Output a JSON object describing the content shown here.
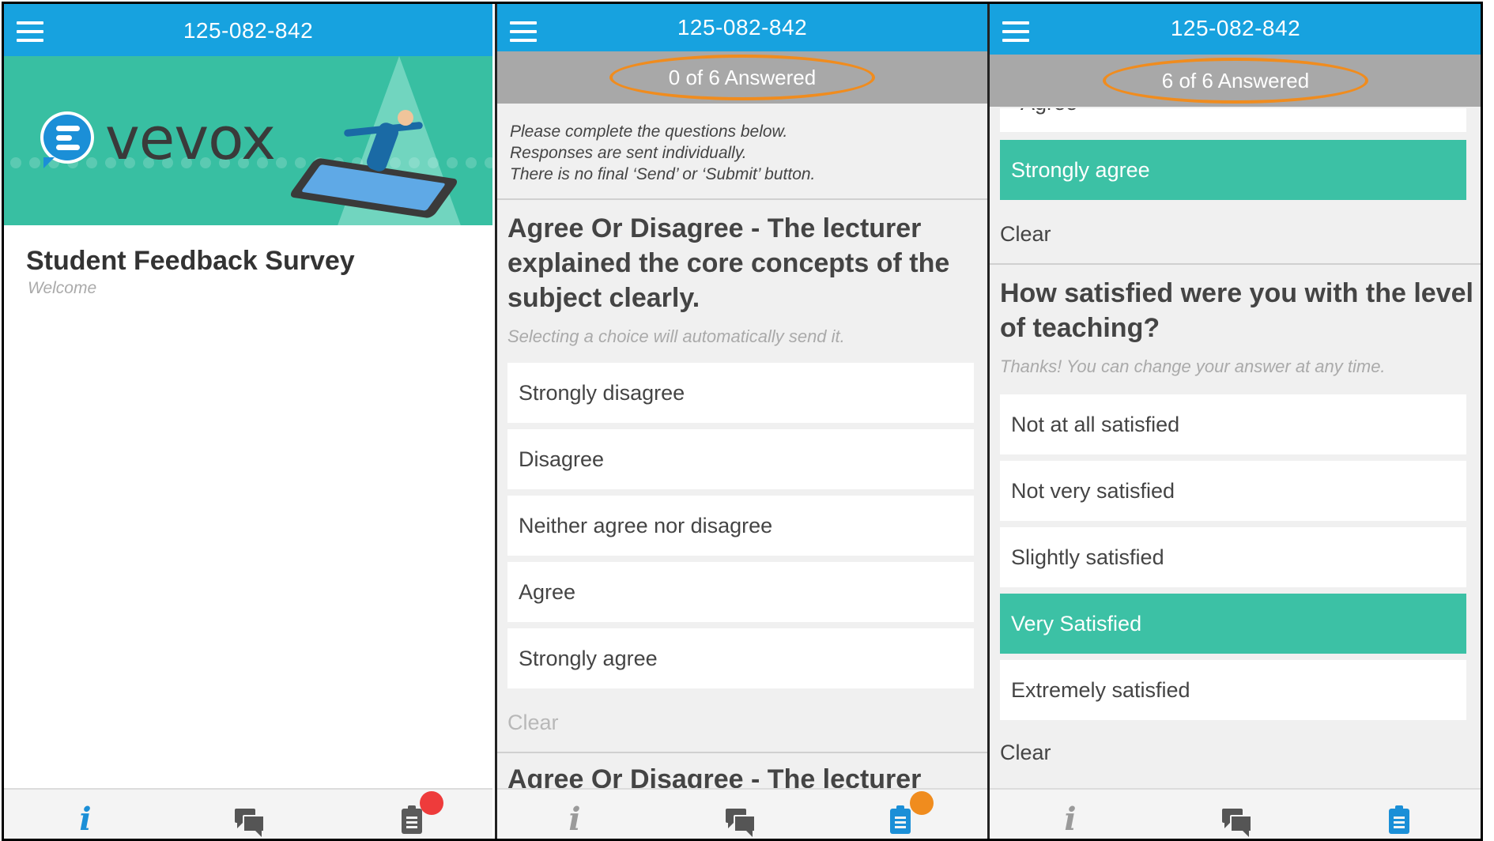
{
  "panels": [
    {
      "session_id": "125-082-842",
      "logo_text": "vevox",
      "survey_title": "Student Feedback Survey",
      "survey_subtitle": "Welcome",
      "nav": {
        "info_icon": "info-icon",
        "chat_icon": "chat-icon",
        "survey_icon": "clipboard-icon",
        "badge_color": "#ee3b3b"
      }
    },
    {
      "session_id": "125-082-842",
      "answered": "0 of 6 Answered",
      "instructions": [
        "Please complete the questions below.",
        "Responses are sent individually.",
        "There is no final ‘Send’ or ‘Submit’ button."
      ],
      "question": {
        "title": "Agree Or Disagree - The lecturer explained the core concepts of the subject clearly.",
        "help": "Selecting a choice will automatically send it.",
        "options": [
          "Strongly disagree",
          "Disagree",
          "Neither agree nor disagree",
          "Agree",
          "Strongly agree"
        ],
        "clear_label": "Clear"
      },
      "next_question_partial": "Agree Or Disagree - The lecturer",
      "nav": {
        "badge_color": "#f08c1e"
      }
    },
    {
      "session_id": "125-082-842",
      "answered": "6 of 6 Answered",
      "previous_partial": "Agree",
      "previous_selected": "Strongly agree",
      "previous_clear": "Clear",
      "question": {
        "title": "How satisfied were you with the level of teaching?",
        "help": "Thanks! You can change your answer at any time.",
        "options": [
          "Not at all satisfied",
          "Not very satisfied",
          "Slightly satisfied",
          "Very Satisfied",
          "Extremely satisfied"
        ],
        "selected_index": 3,
        "clear_label": "Clear"
      }
    }
  ],
  "colors": {
    "topbar": "#17a2df",
    "selected": "#3cc1a5",
    "answered_bar": "#a8a8a8",
    "highlight_ring": "#f08c1e",
    "banner": "#38bfa2"
  }
}
